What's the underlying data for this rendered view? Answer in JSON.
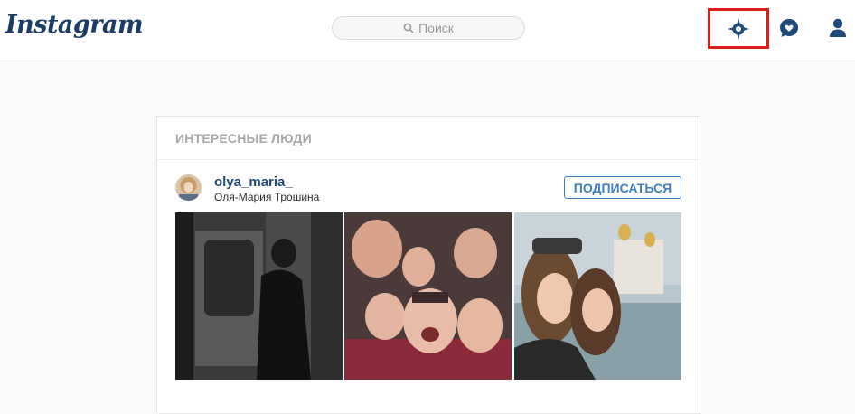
{
  "header": {
    "logo_text": "Instagram",
    "search_placeholder": "Поиск",
    "icons": [
      "search-icon",
      "explore-compass-icon",
      "activity-heart-bubble-icon",
      "profile-person-icon"
    ],
    "highlight_color": "#e01b1b",
    "brand_color": "#1a3d66"
  },
  "suggestions": {
    "title": "ИНТЕРЕСНЫЕ ЛЮДИ",
    "user": {
      "username": "olya_maria_",
      "full_name": "Оля-Мария Трошина",
      "follow_label": "ПОДПИСАТЬСЯ"
    },
    "accent_color": "#3f7fbf"
  }
}
